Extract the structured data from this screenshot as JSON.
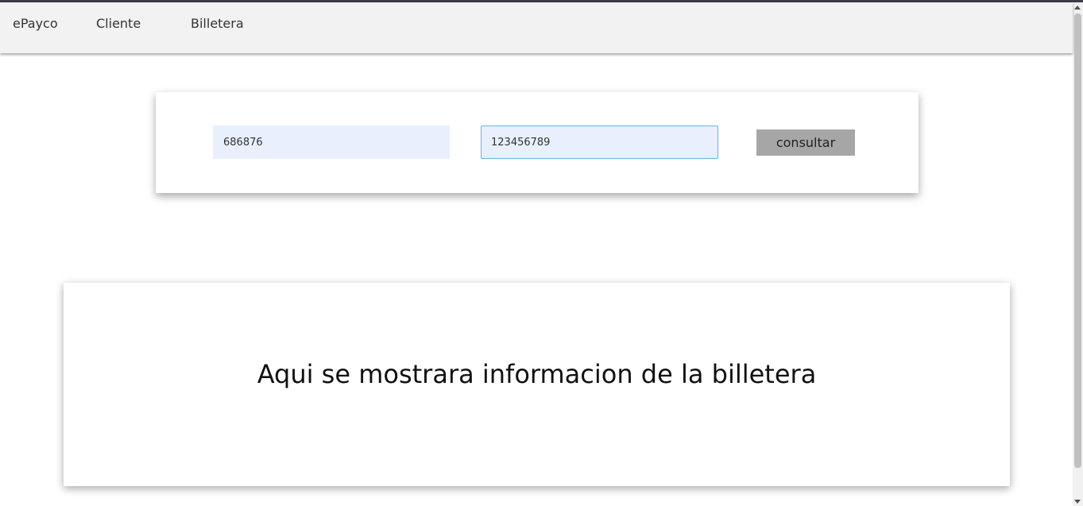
{
  "navbar": {
    "brand": "ePayco",
    "items": [
      {
        "label": "Cliente"
      },
      {
        "label": "Billetera"
      }
    ]
  },
  "search": {
    "document_value": "686876",
    "phone_value": "123456789",
    "button_label": "consultar"
  },
  "info": {
    "message": "Aqui se mostrara informacion de la billetera"
  },
  "colors": {
    "navbar_bg": "#f2f2f2",
    "input_bg": "#e8f0fe",
    "focus_border": "#63b5f0",
    "button_bg": "#a6a6a6"
  }
}
